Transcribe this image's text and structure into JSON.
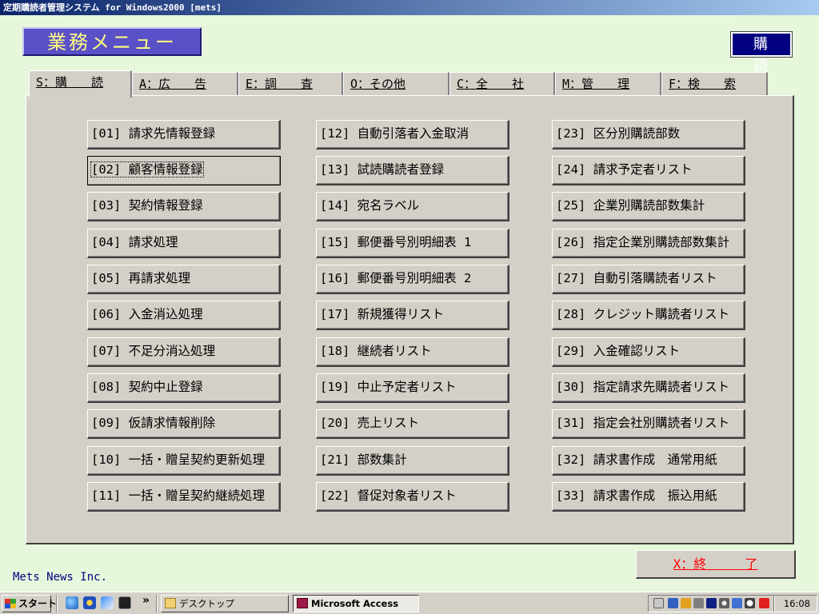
{
  "window": {
    "title": "定期購読者管理システム for Windows2000 [mets]"
  },
  "header": {
    "menu_label": "業務メニュー",
    "mode_badge": "購読"
  },
  "tabs": [
    {
      "label": "S：購　　読",
      "active": true
    },
    {
      "label": "A：広　　告",
      "active": false
    },
    {
      "label": "E：調　　査",
      "active": false
    },
    {
      "label": "O：その他",
      "active": false
    },
    {
      "label": "C：全　　社",
      "active": false
    },
    {
      "label": "M：管　　理",
      "active": false
    },
    {
      "label": "F：検　　索",
      "active": false
    }
  ],
  "menu": {
    "columns": [
      [
        {
          "label": "[01] 請求先情報登録"
        },
        {
          "label": "[02] 顧客情報登録"
        },
        {
          "label": "[03] 契約情報登録"
        },
        {
          "label": "[04] 請求処理"
        },
        {
          "label": "[05] 再請求処理"
        },
        {
          "label": "[06] 入金消込処理"
        },
        {
          "label": "[07] 不足分消込処理"
        },
        {
          "label": "[08] 契約中止登録"
        },
        {
          "label": "[09] 仮請求情報削除"
        },
        {
          "label": "[10] 一括・贈呈契約更新処理"
        },
        {
          "label": "[11] 一括・贈呈契約継続処理"
        }
      ],
      [
        {
          "label": "[12] 自動引落者入金取消"
        },
        {
          "label": "[13] 試読購読者登録"
        },
        {
          "label": "[14] 宛名ラベル"
        },
        {
          "label": "[15] 郵便番号別明細表 1"
        },
        {
          "label": "[16] 郵便番号別明細表 2"
        },
        {
          "label": "[17] 新規獲得リスト"
        },
        {
          "label": "[18] 継続者リスト"
        },
        {
          "label": "[19] 中止予定者リスト"
        },
        {
          "label": "[20] 売上リスト"
        },
        {
          "label": "[21] 部数集計"
        },
        {
          "label": "[22] 督促対象者リスト"
        }
      ],
      [
        {
          "label": "[23] 区分別購読部数"
        },
        {
          "label": "[24] 請求予定者リスト"
        },
        {
          "label": "[25] 企業別購読部数集計"
        },
        {
          "label": "[26] 指定企業別購読部数集計"
        },
        {
          "label": "[27] 自動引落購読者リスト"
        },
        {
          "label": "[28] クレジット購読者リスト"
        },
        {
          "label": "[29] 入金確認リスト"
        },
        {
          "label": "[30] 指定請求先購読者リスト"
        },
        {
          "label": "[31] 指定会社別購読者リスト"
        },
        {
          "label": "[32] 請求書作成　通常用紙"
        },
        {
          "label": "[33] 請求書作成　振込用紙"
        }
      ]
    ],
    "focused_item": "[02] 顧客情報登録"
  },
  "footer": {
    "company": "Mets News Inc.",
    "exit_label": "X：終　　　了"
  },
  "taskbar": {
    "start_label": "スタート",
    "chevron": "»",
    "tasks": [
      {
        "label": "デスクトップ",
        "pressed": false
      },
      {
        "label": "Microsoft Access",
        "pressed": true
      }
    ],
    "clock": "16:08"
  }
}
